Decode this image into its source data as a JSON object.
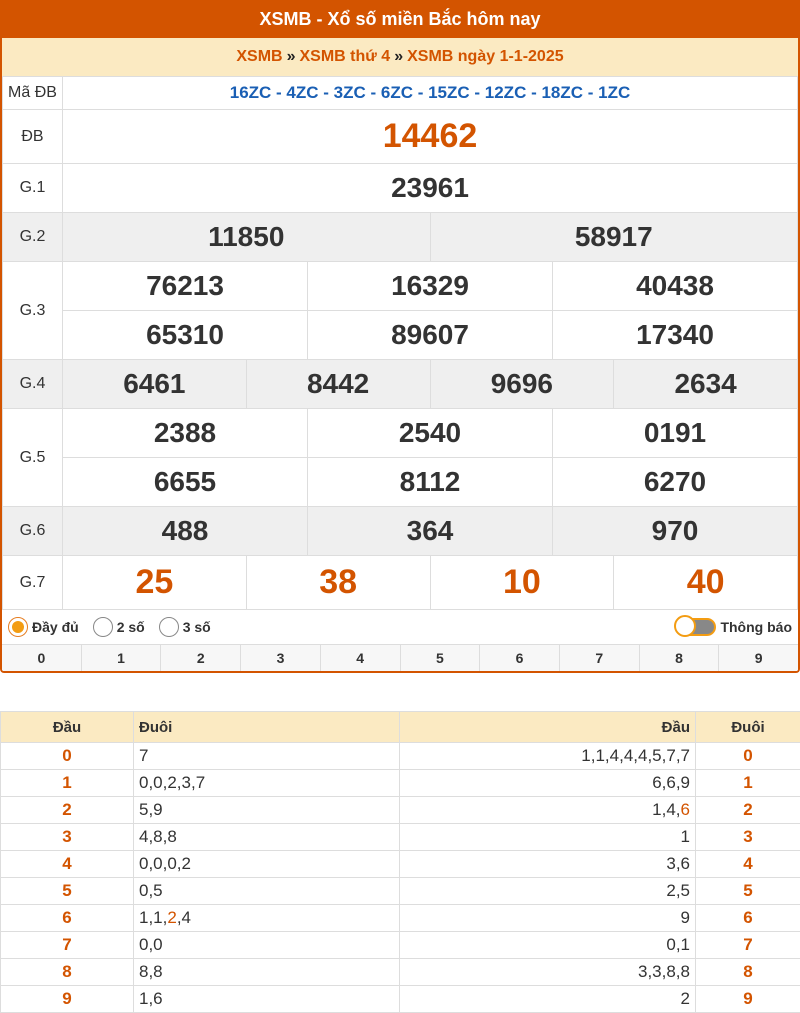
{
  "header": {
    "title": "XSMB - Xổ số miền Bắc hôm nay"
  },
  "breadcrumb": {
    "part1": "XSMB",
    "sep": "»",
    "part2": "XSMB thứ 4",
    "part3": "XSMB ngày 1-1-2025"
  },
  "special_code": {
    "label": "Mã ĐB",
    "codes": "16ZC - 4ZC - 3ZC - 6ZC - 15ZC - 12ZC - 18ZC - 1ZC"
  },
  "prizes": {
    "db": {
      "label": "ĐB",
      "values": [
        "14462"
      ]
    },
    "g1": {
      "label": "G.1",
      "values": [
        "23961"
      ]
    },
    "g2": {
      "label": "G.2",
      "values": [
        "11850",
        "58917"
      ]
    },
    "g3": {
      "label": "G.3",
      "values": [
        "76213",
        "16329",
        "40438",
        "65310",
        "89607",
        "17340"
      ]
    },
    "g4": {
      "label": "G.4",
      "values": [
        "6461",
        "8442",
        "9696",
        "2634"
      ]
    },
    "g5": {
      "label": "G.5",
      "values": [
        "2388",
        "2540",
        "0191",
        "6655",
        "8112",
        "6270"
      ]
    },
    "g6": {
      "label": "G.6",
      "values": [
        "488",
        "364",
        "970"
      ]
    },
    "g7": {
      "label": "G.7",
      "values": [
        "25",
        "38",
        "10",
        "40"
      ]
    }
  },
  "controls": {
    "options": [
      "Đầy đủ",
      "2 số",
      "3 số"
    ],
    "selected": "Đầy đủ",
    "toggle_label": "Thông báo",
    "toggle_on": false
  },
  "digits": [
    "0",
    "1",
    "2",
    "3",
    "4",
    "5",
    "6",
    "7",
    "8",
    "9"
  ],
  "loto": {
    "headers": {
      "dau": "Đầu",
      "duoi": "Đuôi",
      "dau2": "Đầu",
      "duoi2": "Đuôi"
    },
    "rows": [
      {
        "dau": "0",
        "duoi": [
          [
            "7",
            false
          ]
        ],
        "dau2": [
          [
            "1,1,4,4,4,5,7,7",
            false
          ]
        ],
        "duoi2": "0"
      },
      {
        "dau": "1",
        "duoi": [
          [
            "0,0,2,3,7",
            false
          ]
        ],
        "dau2": [
          [
            "6,6,9",
            false
          ]
        ],
        "duoi2": "1"
      },
      {
        "dau": "2",
        "duoi": [
          [
            "5,9",
            false
          ]
        ],
        "dau2": [
          [
            "1,4,",
            false
          ],
          [
            "6",
            true
          ]
        ],
        "duoi2": "2"
      },
      {
        "dau": "3",
        "duoi": [
          [
            "4,8,8",
            false
          ]
        ],
        "dau2": [
          [
            "1",
            false
          ]
        ],
        "duoi2": "3"
      },
      {
        "dau": "4",
        "duoi": [
          [
            "0,0,0,2",
            false
          ]
        ],
        "dau2": [
          [
            "3,6",
            false
          ]
        ],
        "duoi2": "4"
      },
      {
        "dau": "5",
        "duoi": [
          [
            "0,5",
            false
          ]
        ],
        "dau2": [
          [
            "2,5",
            false
          ]
        ],
        "duoi2": "5"
      },
      {
        "dau": "6",
        "duoi": [
          [
            "1,1,",
            false
          ],
          [
            "2",
            true
          ],
          [
            ",4",
            false
          ]
        ],
        "dau2": [
          [
            "9",
            false
          ]
        ],
        "duoi2": "6"
      },
      {
        "dau": "7",
        "duoi": [
          [
            "0,0",
            false
          ]
        ],
        "dau2": [
          [
            "0,1",
            false
          ]
        ],
        "duoi2": "7"
      },
      {
        "dau": "8",
        "duoi": [
          [
            "8,8",
            false
          ]
        ],
        "dau2": [
          [
            "3,3,8,8",
            false
          ]
        ],
        "duoi2": "8"
      },
      {
        "dau": "9",
        "duoi": [
          [
            "1,6",
            false
          ]
        ],
        "dau2": [
          [
            "2",
            false
          ]
        ],
        "duoi2": "9"
      }
    ]
  },
  "colors": {
    "accent": "#d35400",
    "header_bg": "#fbeac2",
    "code_blue": "#1a5fb4"
  }
}
